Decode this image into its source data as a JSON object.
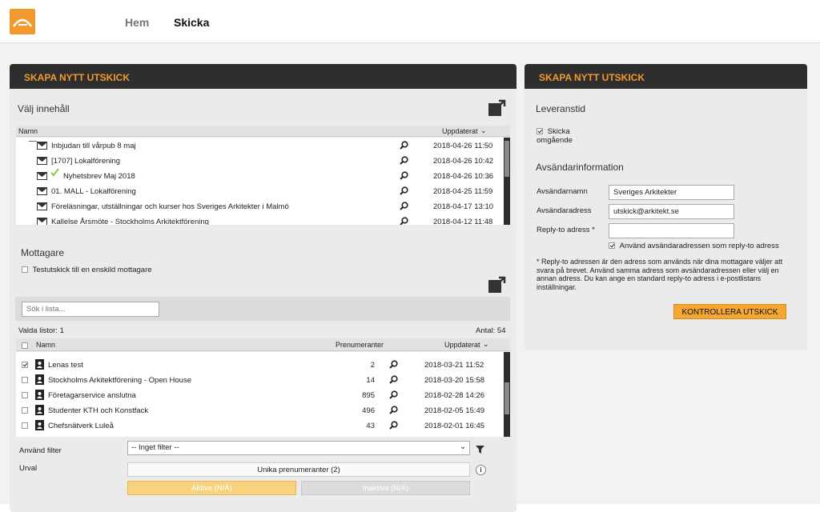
{
  "nav": {
    "home": "Hem",
    "send": "Skicka"
  },
  "left_panel": {
    "title": "SKAPA NYTT UTSKICK",
    "content_section": "Välj innehåll",
    "content_table": {
      "col_name": "Namn",
      "col_updated": "Uppdaterat",
      "rows": [
        {
          "name": "Inbjudan till vårpub 8 maj",
          "date": "2018-04-26 11:50",
          "checked": false
        },
        {
          "name": "[1707] Lokalförening",
          "date": "2018-04-26 10:42",
          "checked": false
        },
        {
          "name": "Nyhetsbrev Maj 2018",
          "date": "2018-04-26 10:36",
          "checked": true
        },
        {
          "name": "01. MALL - Lokalförening",
          "date": "2018-04-25 11:59",
          "checked": false
        },
        {
          "name": "Föreläsningar, utställningar och kurser hos Sveriges Arkitekter i Malmö",
          "date": "2018-04-17 13:10",
          "checked": false
        },
        {
          "name": "Kallelse Årsmöte - Stockholms Arkitektförening",
          "date": "2018-04-12 11:48",
          "checked": false
        }
      ]
    },
    "recipients_section": "Mottagare",
    "test_send_label": "Testutskick till en enskild mottagare",
    "search_placeholder": "Sök i lista...",
    "selected_lists": "Valda listor: 1",
    "count": "Antal: 54",
    "list_table": {
      "col_name": "Namn",
      "col_subscribers": "Prenumeranter",
      "col_updated": "Uppdaterat",
      "rows": [
        {
          "name": "Lenas test",
          "subs": "2",
          "date": "2018-03-21 11:52",
          "checked": true
        },
        {
          "name": "Stockholms Arkitektförening - Open House",
          "subs": "14",
          "date": "2018-03-20 15:58",
          "checked": false
        },
        {
          "name": "Företagarservice anslutna",
          "subs": "895",
          "date": "2018-02-28 14:26",
          "checked": false
        },
        {
          "name": "Studenter KTH och Konstfack",
          "subs": "496",
          "date": "2018-02-05 15:49",
          "checked": false
        },
        {
          "name": "Chefsnätverk Luleå",
          "subs": "43",
          "date": "2018-02-01 16:45",
          "checked": false
        }
      ]
    },
    "filter_label": "Använd filter",
    "filter_value": "-- Inget filter --",
    "selection_label": "Urval",
    "unique_subscribers": "Unika prenumeranter (2)",
    "active": "Aktiva (N/A)",
    "inactive": "Inaktiva (N/A)"
  },
  "right_panel": {
    "title": "SKAPA NYTT UTSKICK",
    "delivery_time": "Leveranstid",
    "send_now_line1": "Skicka",
    "send_now_line2": "omgående",
    "sender_info": "Avsändarinformation",
    "sender_name_label": "Avsändarnamn",
    "sender_name_value": "Sveriges Arkitekter",
    "sender_address_label": "Avsändaradress",
    "sender_address_value": "utskick@arkitekt.se",
    "reply_to_label": "Reply-to adress *",
    "reply_to_value": "",
    "use_sender_as_reply": "Använd avsändaradressen som reply-to adress",
    "note": "* Reply-to adressen är den adress som används när dina mottagare väljer att svara på brevet. Använd samma adress som avsändaradressen eller välj en annan adress. Du kan ange en standard reply-to adress i e-postlistans inställningar.",
    "check_button": "KONTROLLERA UTSKICK"
  },
  "colors": {
    "accent": "#f29a2e",
    "header_dark": "#2e2e2e",
    "panel_bg": "#ebebeb"
  }
}
